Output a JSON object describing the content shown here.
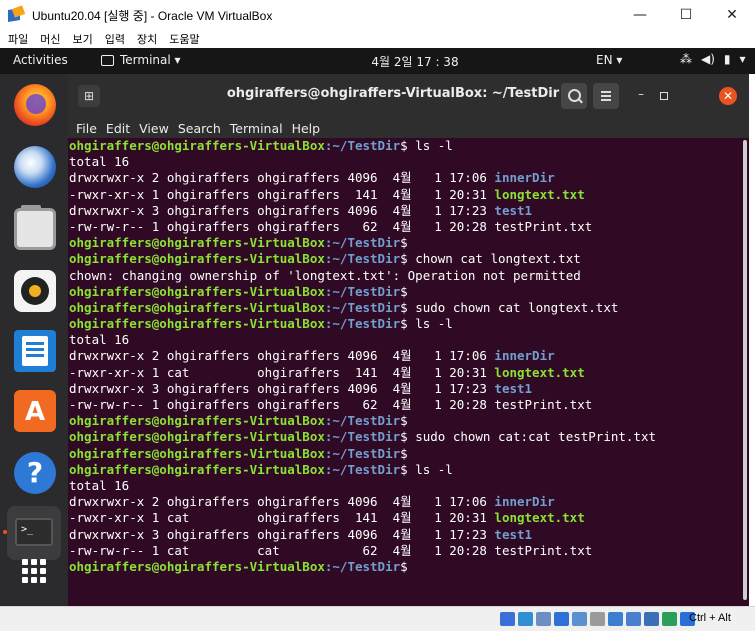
{
  "host_window": {
    "title": "Ubuntu20.04 [실행 중] - Oracle VM VirtualBox",
    "controls": {
      "minimize": "—",
      "maximize": "☐",
      "close": "✕"
    },
    "menu": [
      "파일",
      "머신",
      "보기",
      "입력",
      "장치",
      "도움말"
    ]
  },
  "topbar": {
    "activities": "Activities",
    "app_menu": "Terminal ▾",
    "clock": "4월 2일 17 : 38",
    "input_source": "EN ▾",
    "tray": {
      "network": "⁂",
      "volume": "◀)",
      "battery": "▮",
      "menu": "▾"
    }
  },
  "dock": {
    "items": [
      "firefox-icon",
      "thunderbird-icon",
      "files-icon",
      "rhythmbox-icon",
      "libreoffice-writer-icon",
      "ubuntu-software-icon",
      "help-icon",
      "terminal-icon",
      "show-applications-icon"
    ],
    "software_glyph": "A",
    "help_glyph": "?",
    "terminal_glyph": ">_"
  },
  "terminal": {
    "title": "ohgiraffers@ohgiraffers-VirtualBox: ~/TestDir",
    "newtab_glyph": "⊞",
    "minimize_glyph": "–",
    "close_glyph": "✕",
    "menu": [
      "File",
      "Edit",
      "View",
      "Search",
      "Terminal",
      "Help"
    ],
    "prompt_user": "ohgiraffers@ohgiraffers-VirtualBox",
    "prompt_path": ":~/TestDir",
    "prompt_sym": "$ ",
    "lines": [
      {
        "type": "prompt",
        "cmd": "ls -l"
      },
      {
        "type": "text",
        "text": "total 16"
      },
      {
        "type": "file",
        "meta": "drwxrwxr-x 2 ohgiraffers ohgiraffers 4096  4월   1 17:06 ",
        "name": "innerDir",
        "kind": "dir"
      },
      {
        "type": "file",
        "meta": "-rwxr-xr-x 1 ohgiraffers ohgiraffers  141  4월   1 20:31 ",
        "name": "longtext.txt",
        "kind": "exe"
      },
      {
        "type": "file",
        "meta": "drwxrwxr-x 3 ohgiraffers ohgiraffers 4096  4월   1 17:23 ",
        "name": "test1",
        "kind": "dir"
      },
      {
        "type": "file",
        "meta": "-rw-rw-r-- 1 ohgiraffers ohgiraffers   62  4월   1 20:28 ",
        "name": "testPrint.txt",
        "kind": "plain"
      },
      {
        "type": "prompt",
        "cmd": ""
      },
      {
        "type": "prompt",
        "cmd": "chown cat longtext.txt"
      },
      {
        "type": "text",
        "text": "chown: changing ownership of 'longtext.txt': Operation not permitted"
      },
      {
        "type": "prompt",
        "cmd": ""
      },
      {
        "type": "prompt",
        "cmd": "sudo chown cat longtext.txt"
      },
      {
        "type": "prompt",
        "cmd": "ls -l"
      },
      {
        "type": "text",
        "text": "total 16"
      },
      {
        "type": "file",
        "meta": "drwxrwxr-x 2 ohgiraffers ohgiraffers 4096  4월   1 17:06 ",
        "name": "innerDir",
        "kind": "dir"
      },
      {
        "type": "file",
        "meta": "-rwxr-xr-x 1 cat         ohgiraffers  141  4월   1 20:31 ",
        "name": "longtext.txt",
        "kind": "exe"
      },
      {
        "type": "file",
        "meta": "drwxrwxr-x 3 ohgiraffers ohgiraffers 4096  4월   1 17:23 ",
        "name": "test1",
        "kind": "dir"
      },
      {
        "type": "file",
        "meta": "-rw-rw-r-- 1 ohgiraffers ohgiraffers   62  4월   1 20:28 ",
        "name": "testPrint.txt",
        "kind": "plain"
      },
      {
        "type": "prompt",
        "cmd": ""
      },
      {
        "type": "prompt",
        "cmd": "sudo chown cat:cat testPrint.txt"
      },
      {
        "type": "prompt",
        "cmd": ""
      },
      {
        "type": "prompt",
        "cmd": "ls -l"
      },
      {
        "type": "text",
        "text": "total 16"
      },
      {
        "type": "file",
        "meta": "drwxrwxr-x 2 ohgiraffers ohgiraffers 4096  4월   1 17:06 ",
        "name": "innerDir",
        "kind": "dir"
      },
      {
        "type": "file",
        "meta": "-rwxr-xr-x 1 cat         ohgiraffers  141  4월   1 20:31 ",
        "name": "longtext.txt",
        "kind": "exe"
      },
      {
        "type": "file",
        "meta": "drwxrwxr-x 3 ohgiraffers ohgiraffers 4096  4월   1 17:23 ",
        "name": "test1",
        "kind": "dir"
      },
      {
        "type": "file",
        "meta": "-rw-rw-r-- 1 cat         cat           62  4월   1 20:28 ",
        "name": "testPrint.txt",
        "kind": "plain"
      },
      {
        "type": "prompt",
        "cmd": ""
      }
    ]
  },
  "statusbar": {
    "host_key": "Ctrl + Alt",
    "icon_colors": [
      "#3a6fd8",
      "#2f8fd0",
      "#6a8fc0",
      "#2f6fd8",
      "#5a8fd0",
      "#9a9a9a",
      "#3a7fd0",
      "#4a7fd0",
      "#3a6fb8",
      "#2a9f5a",
      "#2a6fd8"
    ]
  }
}
